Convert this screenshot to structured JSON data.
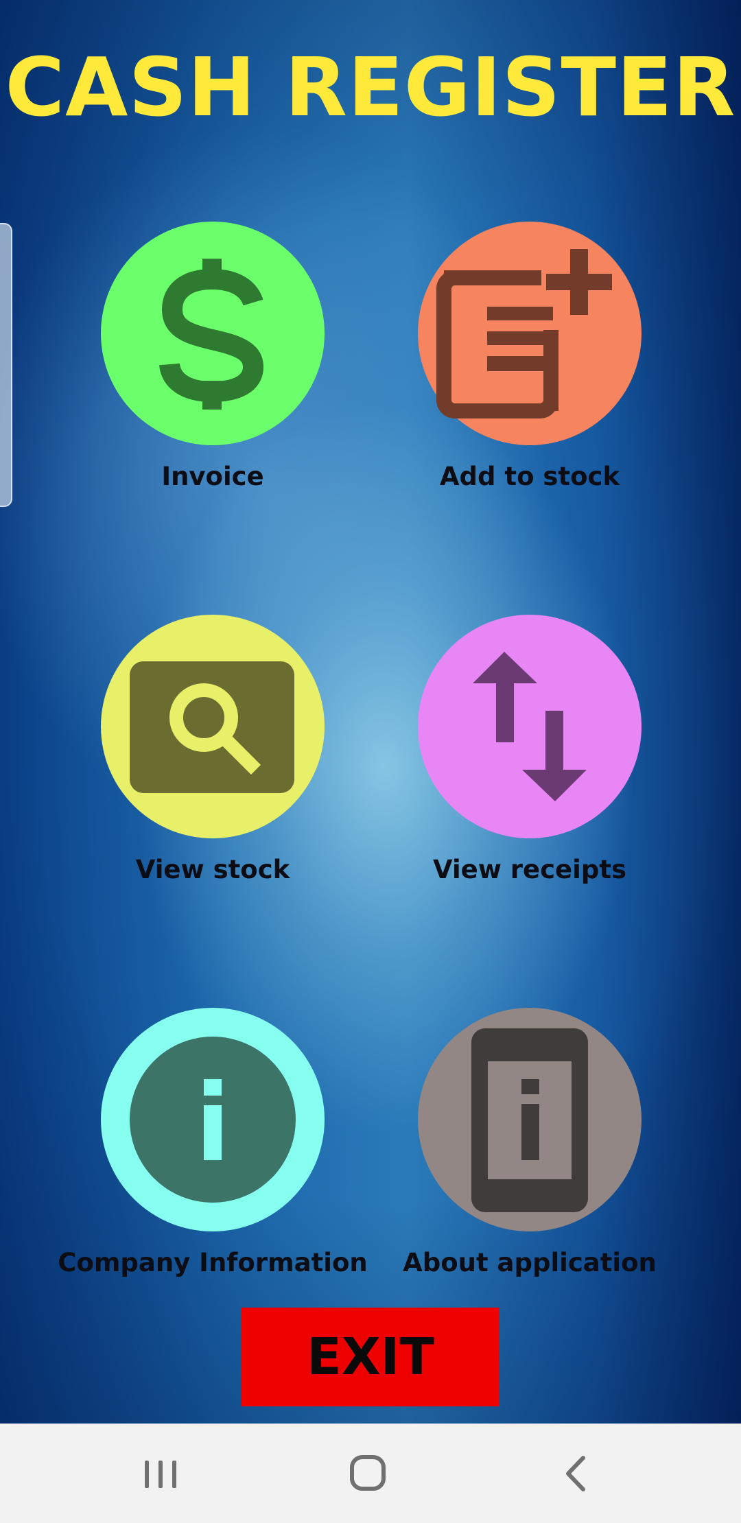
{
  "app": {
    "title": "CASH REGISTER"
  },
  "menu": [
    {
      "id": "invoice",
      "label": "Invoice",
      "icon": "dollar-icon",
      "circle_color": "#6cff6c",
      "icon_color": "#2e7a30"
    },
    {
      "id": "add",
      "label": "Add to stock",
      "icon": "add-note-icon",
      "circle_color": "#f5845f",
      "icon_color": "#733b2a"
    },
    {
      "id": "view_stock",
      "label": "View stock",
      "icon": "search-stock-icon",
      "circle_color": "#e8f06a",
      "icon_color": "#6a6d2f"
    },
    {
      "id": "receipts",
      "label": "View receipts",
      "icon": "swap-vertical-icon",
      "circle_color": "#e986f5",
      "icon_color": "#6b3a73"
    },
    {
      "id": "company",
      "label": "Company Information",
      "icon": "info-icon",
      "circle_color": "#86fff0",
      "icon_color": "#3c7468"
    },
    {
      "id": "about",
      "label": "About application",
      "icon": "phone-info-icon",
      "circle_color": "#928785",
      "icon_color": "#403c3b"
    }
  ],
  "exit_button": {
    "label": "EXIT",
    "color": "#ee0000"
  },
  "navbar": {
    "items": [
      "recent-apps-icon",
      "home-icon",
      "back-icon"
    ]
  }
}
